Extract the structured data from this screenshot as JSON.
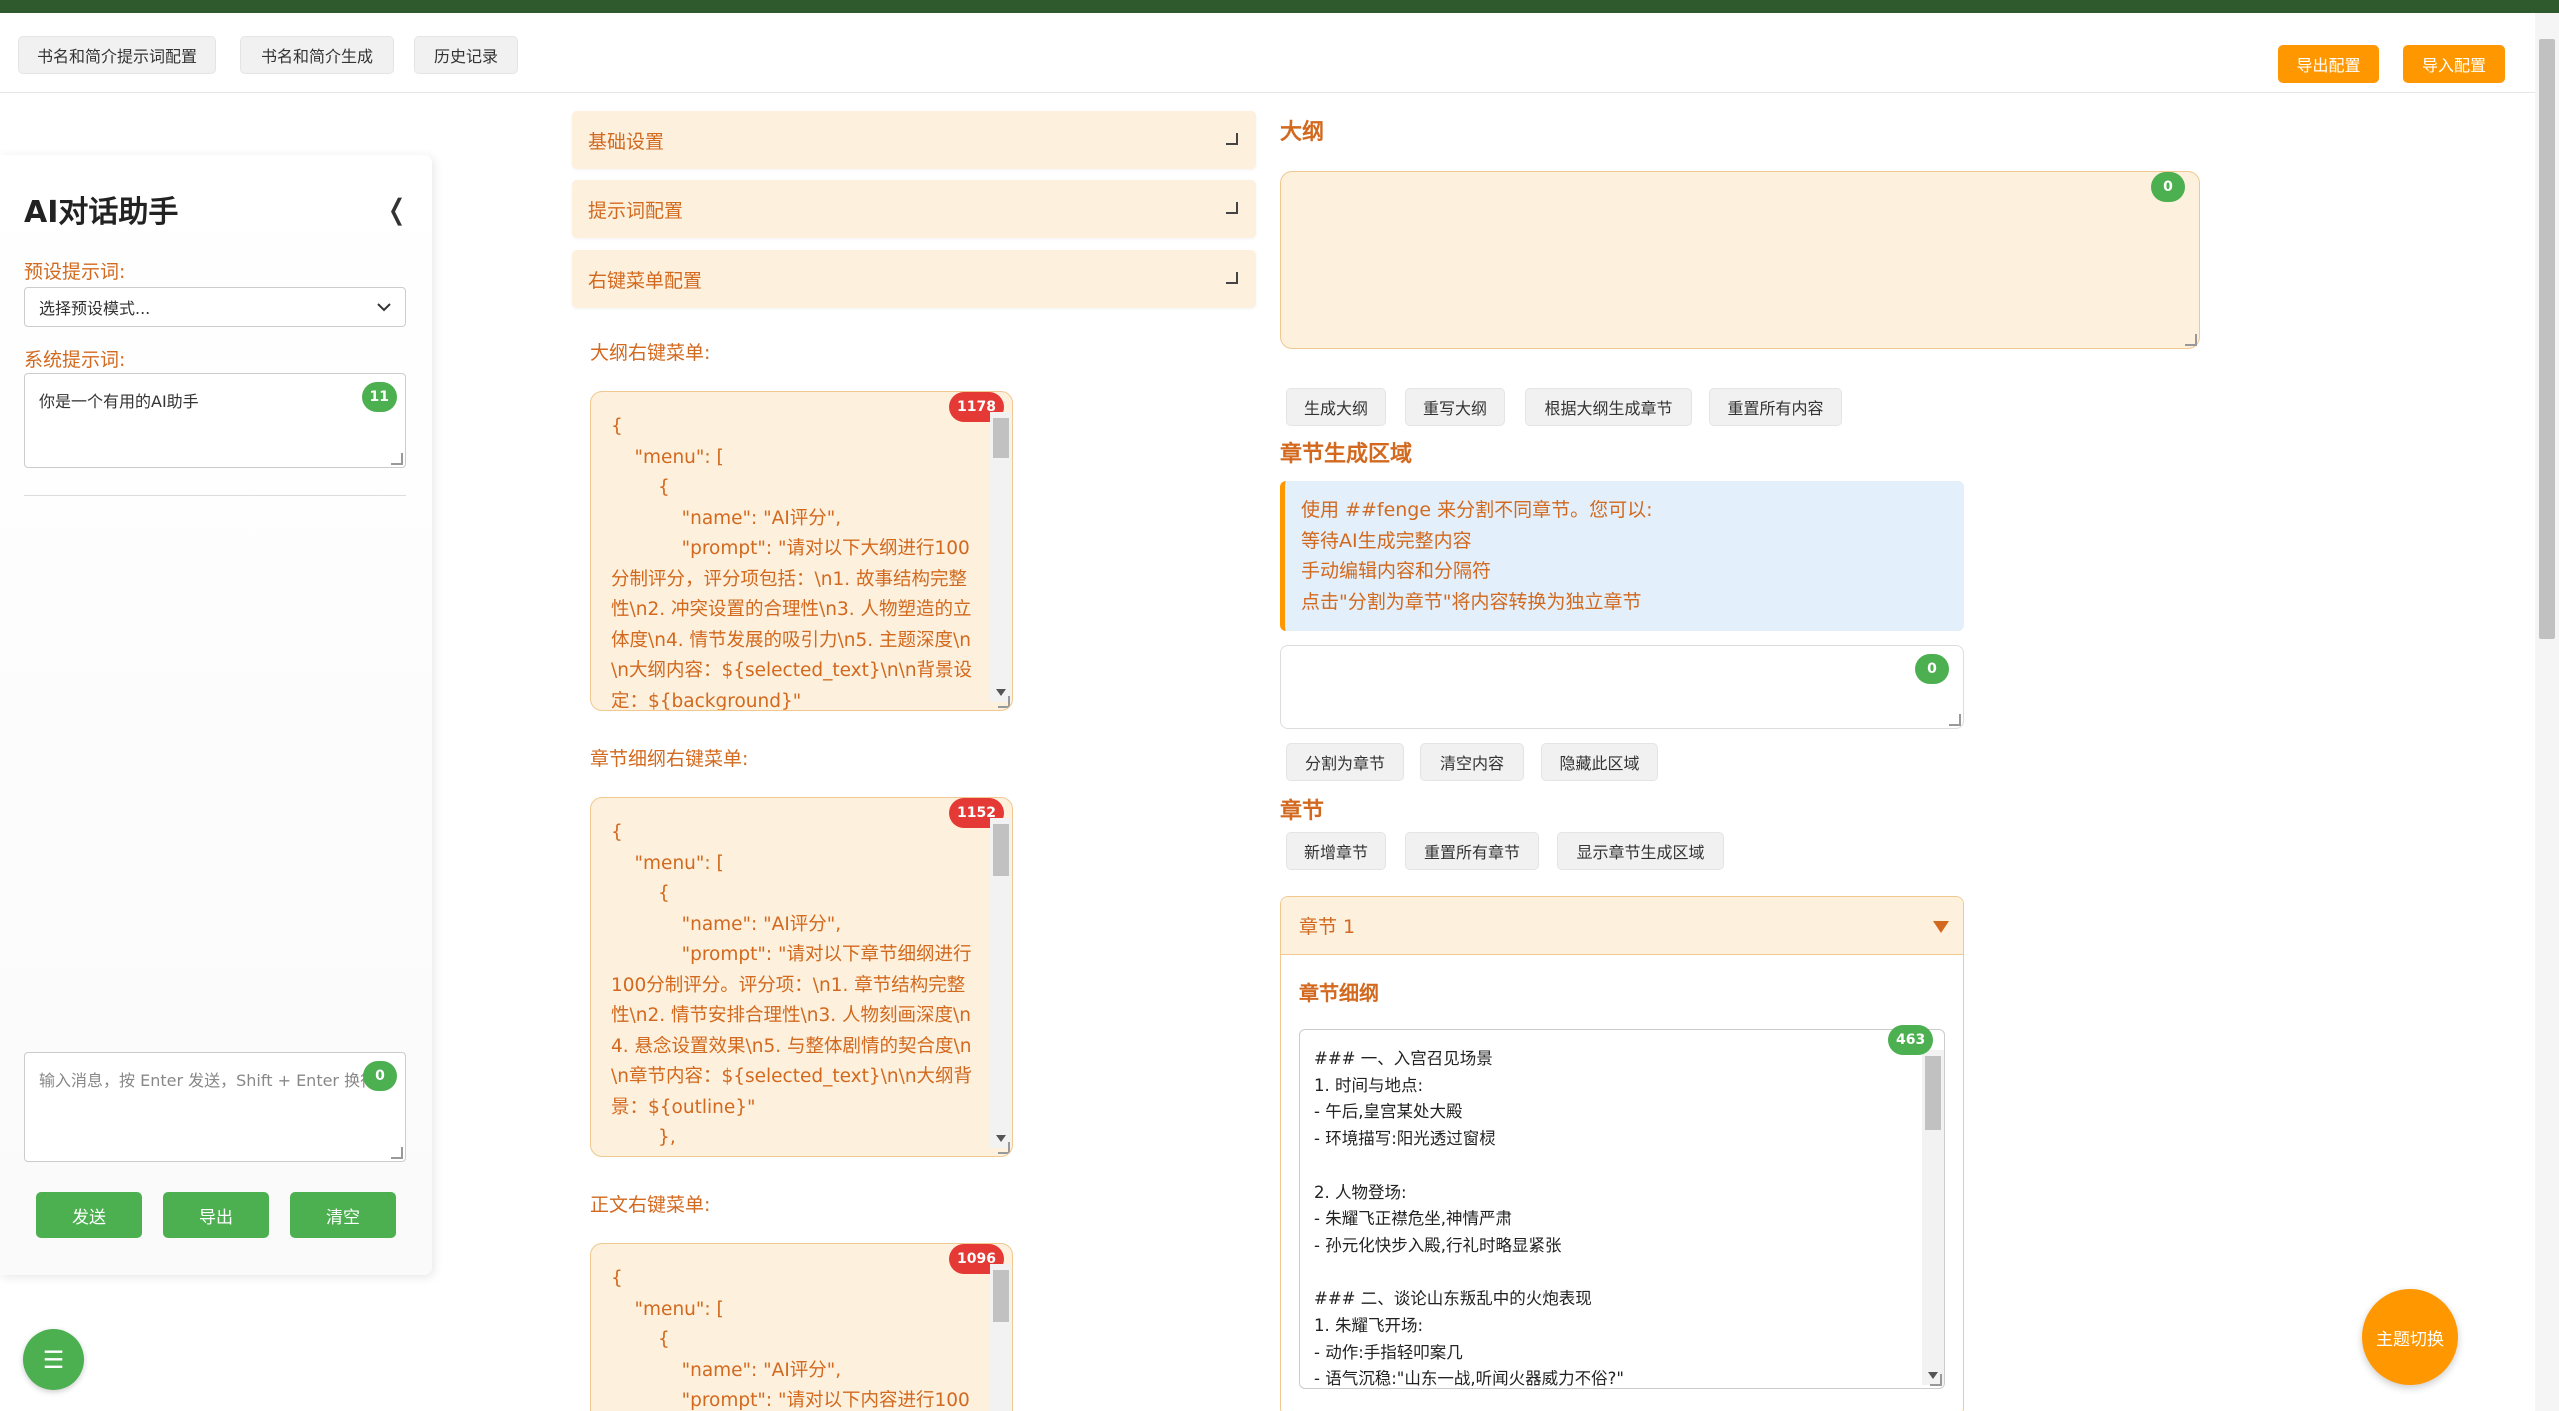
{
  "nav": {
    "tab_prompt_config": "书名和简介提示词配置",
    "tab_generate": "书名和简介生成",
    "tab_history": "历史记录",
    "export_config": "导出配置",
    "import_config": "导入配置"
  },
  "ai_assistant": {
    "title": "AI对话助手",
    "collapse_symbol": "❬",
    "preset_label": "预设提示词:",
    "preset_selected": "选择预设模式...",
    "system_label": "系统提示词:",
    "system_value": "你是一个有用的AI助手",
    "system_count": "11",
    "message_placeholder": "输入消息，按 Enter 发送，Shift + Enter 换行",
    "message_count": "0",
    "send": "发送",
    "export": "导出",
    "clear": "清空"
  },
  "config": {
    "basic_settings": "基础设置",
    "prompt_config": "提示词配置",
    "context_menu_config": "右键菜单配置",
    "outline_menu_label": "大纲右键菜单:",
    "outline_menu_count": "1178",
    "outline_menu_text": "{\n    \"menu\": [\n        {\n            \"name\": \"AI评分\",\n            \"prompt\": \"请对以下大纲进行100分制评分，评分项包括：\\n1. 故事结构完整性\\n2. 冲突设置的合理性\\n3. 人物塑造的立体度\\n4. 情节发展的吸引力\\n5. 主题深度\\n\\n大纲内容：${selected_text}\\n\\n背景设定：${background}\"",
    "chapter_outline_menu_label": "章节细纲右键菜单:",
    "chapter_outline_menu_count": "1152",
    "chapter_outline_menu_text": "{\n    \"menu\": [\n        {\n            \"name\": \"AI评分\",\n            \"prompt\": \"请对以下章节细纲进行100分制评分。评分项：\\n1. 章节结构完整性\\n2. 情节安排合理性\\n3. 人物刻画深度\\n4. 悬念设置效果\\n5. 与整体剧情的契合度\\n\\n章节内容：${selected_text}\\n\\n大纲背景：${outline}\"\n        },",
    "body_menu_label": "正文右键菜单:",
    "body_menu_count": "1096",
    "body_menu_text": "{\n    \"menu\": [\n        {\n            \"name\": \"AI评分\",\n            \"prompt\": \"请对以下内容进行100"
  },
  "outline": {
    "title": "大纲",
    "count": "0",
    "btn_generate": "生成大纲",
    "btn_rewrite": "重写大纲",
    "btn_gen_chapters": "根据大纲生成章节",
    "btn_reset_all": "重置所有内容"
  },
  "chapter_gen": {
    "title": "章节生成区域",
    "info": [
      "使用 ##fenge 来分割不同章节。您可以:",
      "等待AI生成完整内容",
      "手动编辑内容和分隔符",
      "点击\"分割为章节\"将内容转换为独立章节"
    ],
    "count": "0",
    "btn_split": "分割为章节",
    "btn_clear": "清空内容",
    "btn_hide": "隐藏此区域"
  },
  "chapters": {
    "title": "章节",
    "btn_add": "新增章节",
    "btn_reset": "重置所有章节",
    "btn_show_gen": "显示章节生成区域",
    "chapter1_title": "章节 1",
    "detail_label": "章节细纲",
    "detail_count": "463",
    "detail_text": "### 一、入宫召见场景\n1. 时间与地点:\n- 午后,皇宫某处大殿\n- 环境描写:阳光透过窗棂\n\n2. 人物登场:\n- 朱耀飞正襟危坐,神情严肃\n- 孙元化快步入殿,行礼时略显紧张\n\n### 二、谈论山东叛乱中的火炮表现\n1. 朱耀飞开场:\n- 动作:手指轻叩案几\n- 语气沉稳:\"山东一战,听闻火器威力不俗?\""
  },
  "theme_toggle": "主题切换",
  "fab_menu_icon": "☰",
  "colors": {
    "accent_orange": "#ff9800",
    "text_orange": "#d2691e",
    "panel_bg": "#fdf0dc",
    "green": "#4caf50",
    "badge_red": "#e53935",
    "info_bg": "#e3f0fb"
  }
}
